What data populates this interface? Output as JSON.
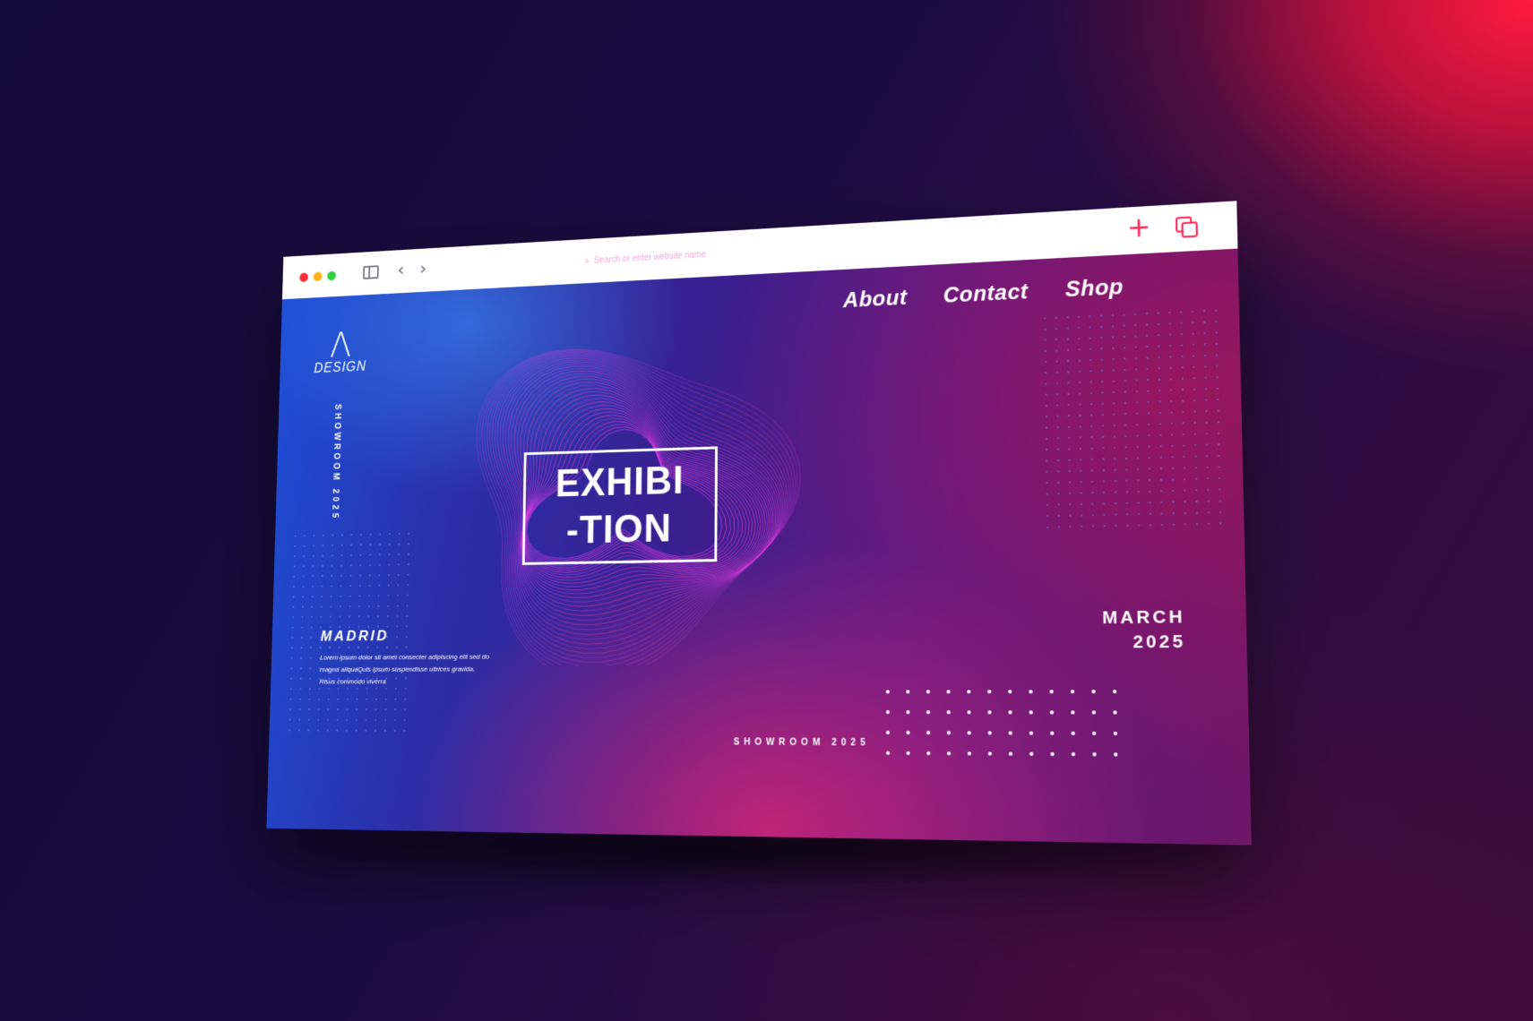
{
  "browser": {
    "address_placeholder": "Search or enter website name"
  },
  "site": {
    "logo_mark": "Λ",
    "logo_text": "DESIGN",
    "vertical_label": "SHOWROOM 2025",
    "menu": [
      {
        "label": "About"
      },
      {
        "label": "Contact"
      },
      {
        "label": "Shop"
      }
    ],
    "title_line1": "EXHIBI",
    "title_line2": "-TION",
    "city": "MADRID",
    "description": "Lorem ipsum dolor sit amet consecter adipiscing elit sed do magna aliquaQuis ipsum suspendisse ultrices gravida. Risus commodo viverra",
    "date_month": "MARCH",
    "date_year": "2025",
    "showroom_label": "SHOWROOM 2025"
  },
  "colors": {
    "accent": "#ff2a5a",
    "blob_primary": "#c23cff",
    "blob_secondary": "#ff3cc8"
  }
}
